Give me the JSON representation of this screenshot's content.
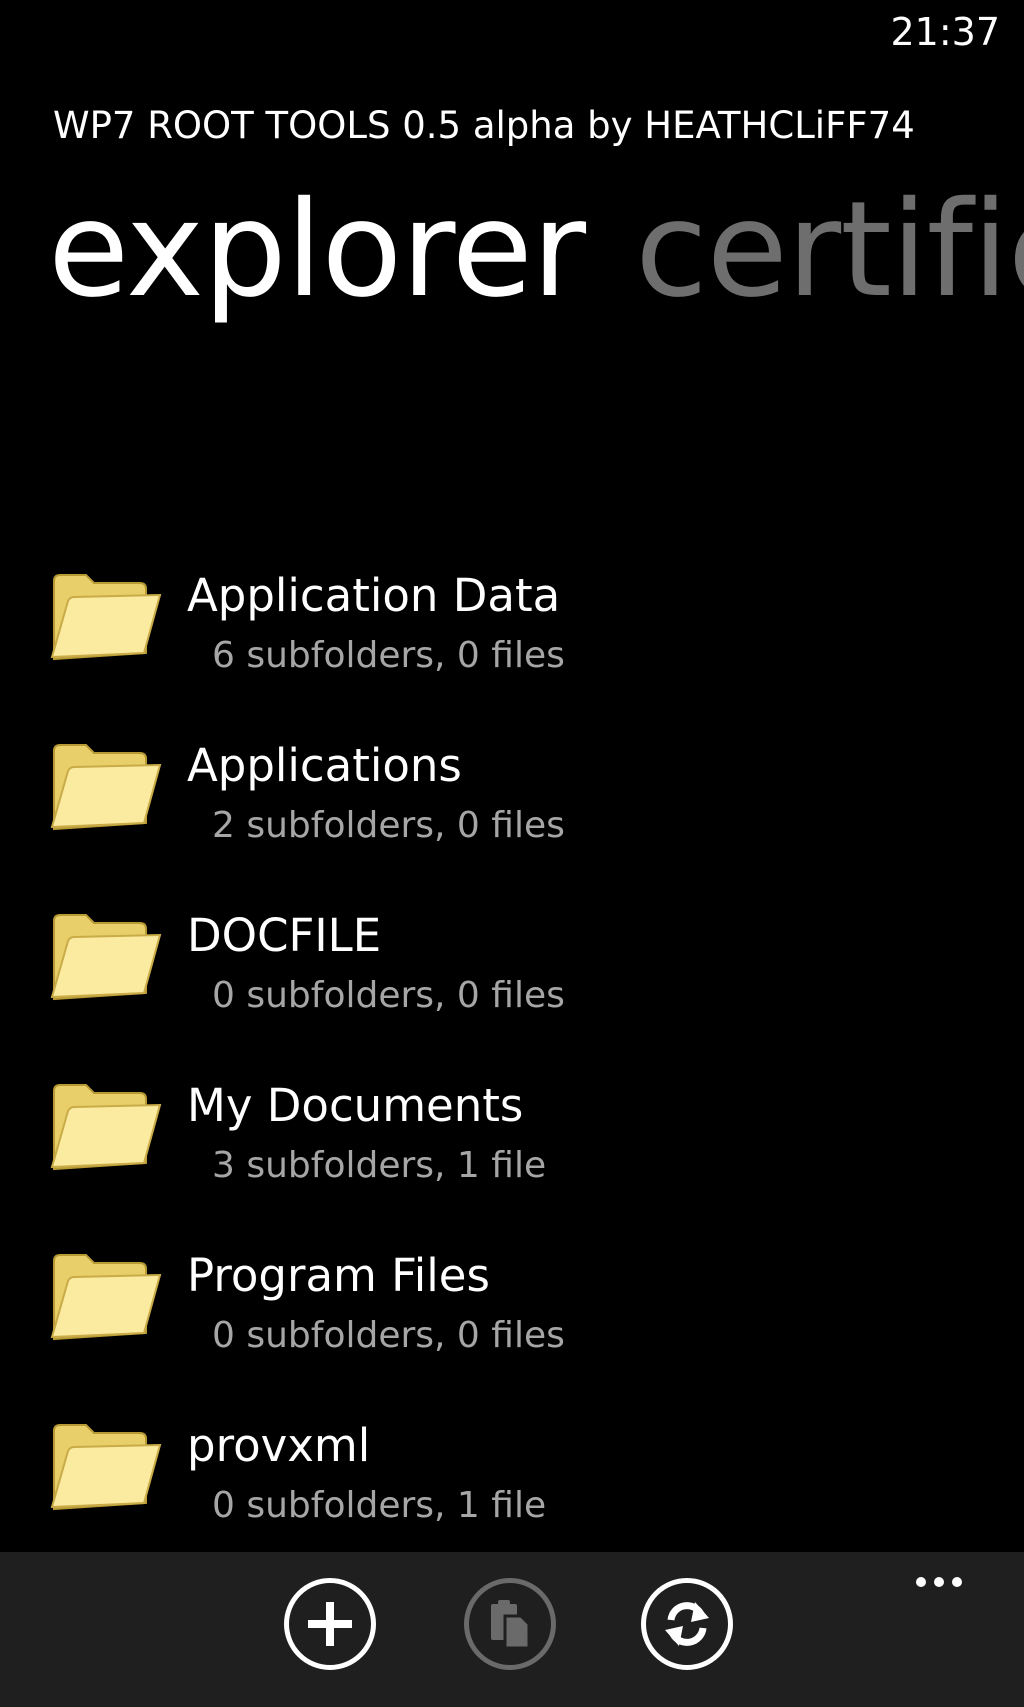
{
  "status_bar": {
    "time": "21:37"
  },
  "app": {
    "title": "WP7 ROOT TOOLS 0.5 alpha by HEATHCLiFF74"
  },
  "pivot": {
    "active": "explorer",
    "next": "certific"
  },
  "files": [
    {
      "name": "Application Data",
      "meta": "6 subfolders, 0 files",
      "icon": "folder-icon"
    },
    {
      "name": "Applications",
      "meta": "2 subfolders, 0 files",
      "icon": "folder-icon"
    },
    {
      "name": "DOCFILE",
      "meta": "0 subfolders, 0 files",
      "icon": "folder-icon"
    },
    {
      "name": "My Documents",
      "meta": "3 subfolders, 1 file",
      "icon": "folder-icon"
    },
    {
      "name": "Program Files",
      "meta": "0 subfolders, 0 files",
      "icon": "folder-icon"
    },
    {
      "name": "provxml",
      "meta": "0 subfolders, 1 file",
      "icon": "folder-icon"
    }
  ],
  "app_bar": {
    "buttons": [
      {
        "icon": "add-icon",
        "enabled": true
      },
      {
        "icon": "paste-icon",
        "enabled": false
      },
      {
        "icon": "refresh-icon",
        "enabled": true
      }
    ],
    "more": "more-dots-icon"
  },
  "colors": {
    "background": "#000000",
    "app_bar": "#1f1f1f",
    "secondary_text": "#a6a6a6",
    "inactive_pivot": "#6e6e6e",
    "folder_yellow": "#f7e48a"
  }
}
